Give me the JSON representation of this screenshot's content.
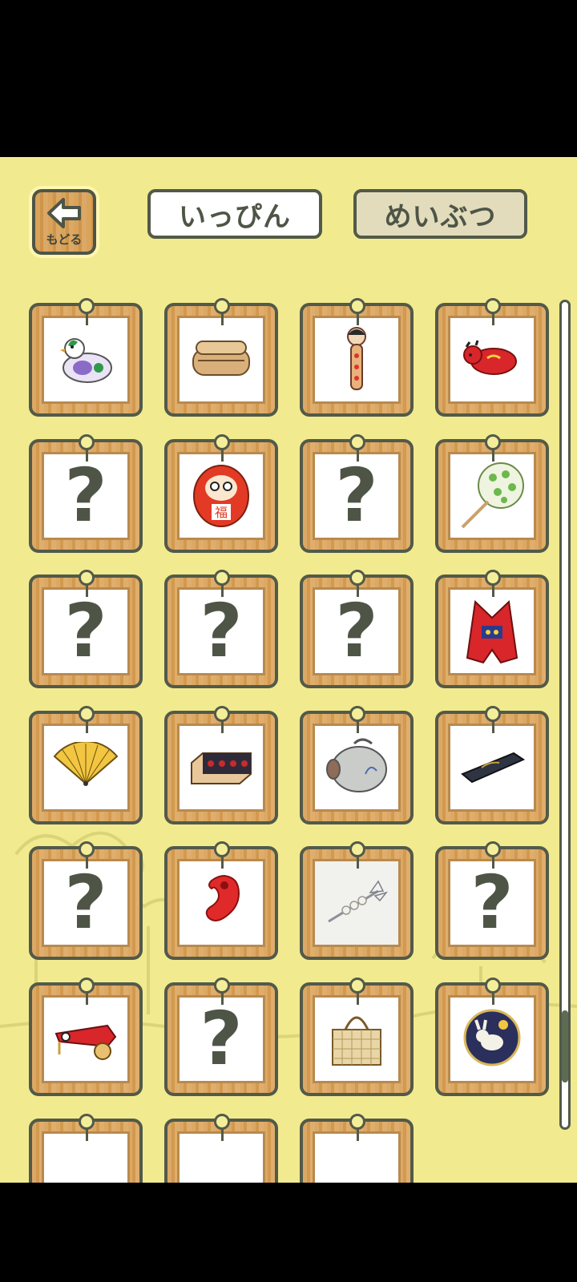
{
  "header": {
    "back_label": "もどる",
    "tab_items": "いっぴん",
    "tab_specialties": "めいぶつ"
  },
  "grid": {
    "cards": [
      {
        "state": "found",
        "icon": "pigeon-whistle-icon"
      },
      {
        "state": "found",
        "icon": "bento-box-icon"
      },
      {
        "state": "found",
        "icon": "kokeshi-doll-icon"
      },
      {
        "state": "found",
        "icon": "red-cow-toy-icon"
      },
      {
        "state": "unknown",
        "label": "?"
      },
      {
        "state": "found",
        "icon": "daruma-icon"
      },
      {
        "state": "unknown",
        "label": "?"
      },
      {
        "state": "found",
        "icon": "uchiwa-fan-icon"
      },
      {
        "state": "unknown",
        "label": "?"
      },
      {
        "state": "unknown",
        "label": "?"
      },
      {
        "state": "unknown",
        "label": "?"
      },
      {
        "state": "found",
        "icon": "red-vest-icon"
      },
      {
        "state": "found",
        "icon": "folding-fan-icon"
      },
      {
        "state": "found",
        "icon": "sweets-box-icon"
      },
      {
        "state": "found",
        "icon": "pig-incense-holder-icon"
      },
      {
        "state": "found",
        "icon": "lacquer-box-icon"
      },
      {
        "state": "unknown",
        "label": "?"
      },
      {
        "state": "found",
        "icon": "red-magatama-icon"
      },
      {
        "state": "found",
        "icon": "pearl-hairpin-icon"
      },
      {
        "state": "unknown",
        "label": "?"
      },
      {
        "state": "found",
        "icon": "carp-cart-toy-icon"
      },
      {
        "state": "unknown",
        "label": "?"
      },
      {
        "state": "found",
        "icon": "bamboo-basket-icon"
      },
      {
        "state": "found",
        "icon": "rabbit-plate-icon"
      },
      {
        "state": "partial",
        "icon": "partial-item-icon"
      },
      {
        "state": "partial",
        "icon": "partial-item-icon"
      },
      {
        "state": "partial",
        "icon": "partial-item-icon"
      }
    ]
  },
  "scrollbar": {
    "position": 0.94
  }
}
